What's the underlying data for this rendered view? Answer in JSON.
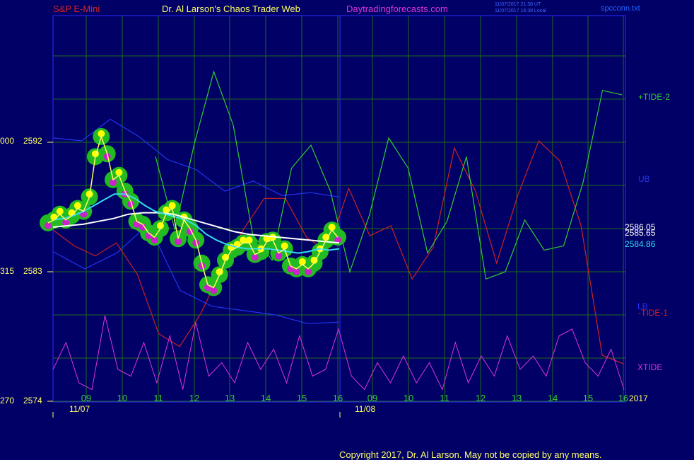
{
  "header": {
    "symbol": "S&P E-Mini",
    "site_title": "Dr. Al Larson's Chaos Trader Web",
    "site_url": "Daytradingforecasts.com",
    "stamp_utc": "11/07/2017 21:38 UT",
    "stamp_local": "11/07/2017 16:38 Local",
    "file_name": "spcconn.txt"
  },
  "footer": {
    "copyright": "Copyright 2017, Dr. Al Larson. May not be copied by any means."
  },
  "colors": {
    "background": "#000066",
    "grid": "#1f6a1f",
    "frame": "#2a2aff",
    "price": "#ffffff",
    "cyan_ma": "#33ddee",
    "white_ma": "#ffffff",
    "tide2": "#33cc33",
    "tide1": "#cc2222",
    "bands": "#2233ee",
    "xtide": "#dd33dd",
    "highlight_outer": "#22bb22",
    "highlight_dot": "#ffff00",
    "low_dot": "#cc22cc"
  },
  "chart_data": {
    "type": "line",
    "title": "S&P E-Mini",
    "y_axis": {
      "ylim": [
        2574,
        2595
      ],
      "tick_labels": [
        {
          "left": "000",
          "right": "2592",
          "value": 2592
        },
        {
          "left": "315",
          "right": "2583",
          "value": 2583
        },
        {
          "left": "270",
          "right": "2574",
          "value": 2574
        }
      ]
    },
    "x_axis": {
      "hour_labels": [
        "09",
        "10",
        "11",
        "12",
        "13",
        "14",
        "15",
        "16",
        "09",
        "10",
        "11",
        "12",
        "13",
        "14",
        "15",
        "16"
      ],
      "date_labels": [
        "11/07",
        "11/08"
      ],
      "year_label": "2017",
      "grid": true
    },
    "series": [
      {
        "name": "price",
        "values": [
          2586.4,
          2586.6,
          2587.0,
          2586.6,
          2586.9,
          2587.4,
          2587.2,
          2588.2,
          2591.0,
          2592.4,
          2591.2,
          2589.4,
          2589.7,
          2588.6,
          2587.9,
          2586.5,
          2586.3,
          2585.7,
          2585.4,
          2586.0,
          2587.1,
          2587.4,
          2585.3,
          2586.6,
          2586.0,
          2585.2,
          2583.6,
          2582.1,
          2581.9,
          2582.8,
          2583.8,
          2584.5,
          2584.7,
          2585.0,
          2585.0,
          2584.2,
          2584.4,
          2585.1,
          2585.2,
          2584.3,
          2584.6,
          2583.4,
          2583.2,
          2583.5,
          2583.2,
          2583.6,
          2584.4,
          2585.2,
          2585.9,
          2585.4
        ]
      },
      {
        "name": "cyan",
        "values": [
          2586.6,
          2586.7,
          2586.9,
          2587.2,
          2587.6,
          2588.0,
          2588.4,
          2588.4,
          2588.1,
          2587.6,
          2587.2,
          2587.0,
          2586.8,
          2586.6,
          2586.2,
          2585.6,
          2585.2,
          2584.9,
          2584.7,
          2584.6,
          2584.6,
          2584.6,
          2584.5,
          2584.4,
          2584.3,
          2584.4,
          2584.6,
          2584.5,
          2584.6
        ]
      },
      {
        "name": "white",
        "values": [
          2586.1,
          2586.2,
          2586.3,
          2586.5,
          2586.7,
          2587.0,
          2587.1,
          2587.1,
          2587.0,
          2586.7,
          2586.4,
          2586.1,
          2585.8,
          2585.6,
          2585.5,
          2585.4,
          2585.3,
          2585.2,
          2585.1,
          2585.0
        ]
      },
      {
        "name": "+TIDE-2",
        "values": [
          2591.0,
          2585.9,
          2591.9,
          2596.9,
          2593.2,
          2585.6,
          2583.8,
          2590.2,
          2591.8,
          2588.6,
          2583.0,
          2586.9,
          2592.3,
          2590.2,
          2584.3,
          2586.5,
          2591.0,
          2582.5,
          2583.0,
          2586.6,
          2584.5,
          2584.8,
          2589.2,
          2595.6,
          2595.3
        ]
      },
      {
        "name": "-TIDE-1",
        "values": [
          2585.9,
          2584.8,
          2584.1,
          2585.0,
          2582.8,
          2578.7,
          2577.8,
          2580.1,
          2583.2,
          2585.9,
          2588.1,
          2588.1,
          2585.4,
          2584.4,
          2588.8,
          2585.5,
          2586.2,
          2582.5,
          2584.7,
          2591.6,
          2588.6,
          2583.6,
          2588.3,
          2592.1,
          2590.7,
          2586.2,
          2577.2,
          2576.6
        ]
      },
      {
        "name": "UB",
        "values": [
          2592.3,
          2592.1,
          2593.6,
          2592.4,
          2590.8,
          2590.1,
          2588.6,
          2589.3,
          2588.3,
          2588.5,
          2588.2
        ]
      },
      {
        "name": "LB",
        "values": [
          2584.4,
          2583.2,
          2584.3,
          2586.3,
          2581.7,
          2580.6,
          2580.3,
          2580.0,
          2579.4,
          2579.5
        ]
      },
      {
        "name": "XTIDE",
        "values": [
          0.4,
          0.8,
          0.2,
          0.1,
          1.2,
          0.4,
          0.3,
          0.8,
          0.2,
          0.9,
          0.1,
          1.1,
          0.3,
          0.5,
          0.2,
          0.8,
          0.4,
          0.7,
          0.2,
          0.9,
          0.3,
          0.4,
          1.0,
          0.3,
          0.1,
          0.5,
          0.2,
          0.6,
          0.2,
          0.5,
          0.1,
          0.8,
          0.2,
          0.6,
          0.3,
          0.9,
          0.4,
          0.6,
          0.3,
          0.9,
          1.0,
          0.5,
          0.3,
          0.7,
          0.1
        ]
      }
    ],
    "right_labels": [
      {
        "text": "+TIDE-2",
        "series": "+TIDE-2"
      },
      {
        "text": "UB",
        "series": "UB"
      },
      {
        "text": "2586.05",
        "series": "price"
      },
      {
        "text": "2585.65",
        "series": "white"
      },
      {
        "text": "2584.86",
        "series": "cyan"
      },
      {
        "text": "LB",
        "series": "LB"
      },
      {
        "text": "-TIDE-1",
        "series": "-TIDE-1"
      },
      {
        "text": "XTIDE",
        "series": "XTIDE"
      }
    ]
  }
}
